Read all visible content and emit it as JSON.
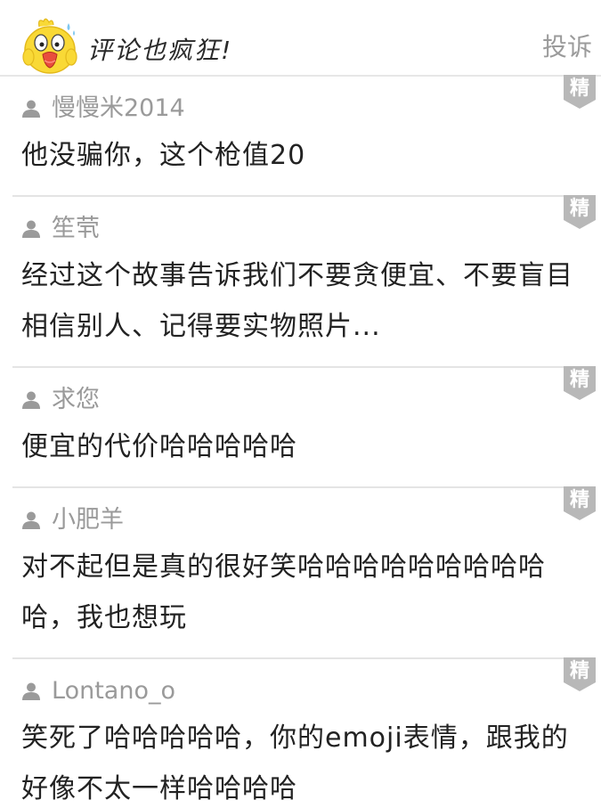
{
  "header": {
    "title": "评论也疯狂!",
    "report_label": "投诉"
  },
  "badge_label": "精",
  "colors": {
    "badge_bg": "#b8b8b8",
    "username": "#9a9a9a",
    "text": "#222222",
    "divider": "#e4e4e4",
    "mascot_yellow": "#f9d936"
  },
  "comments": [
    {
      "username": "慢慢米2014",
      "text": "他没骗你，这个枪值20"
    },
    {
      "username": "笙茕",
      "text": "经过这个故事告诉我们不要贪便宜、不要盲目相信别人、记得要实物照片..."
    },
    {
      "username": "求您",
      "text": "便宜的代价哈哈哈哈哈"
    },
    {
      "username": "小肥羊",
      "text": "对不起但是真的很好笑哈哈哈哈哈哈哈哈哈哈，我也想玩"
    },
    {
      "username": "Lontano_o",
      "text": "笑死了哈哈哈哈哈，你的emoji表情，跟我的好像不太一样哈哈哈哈"
    }
  ]
}
